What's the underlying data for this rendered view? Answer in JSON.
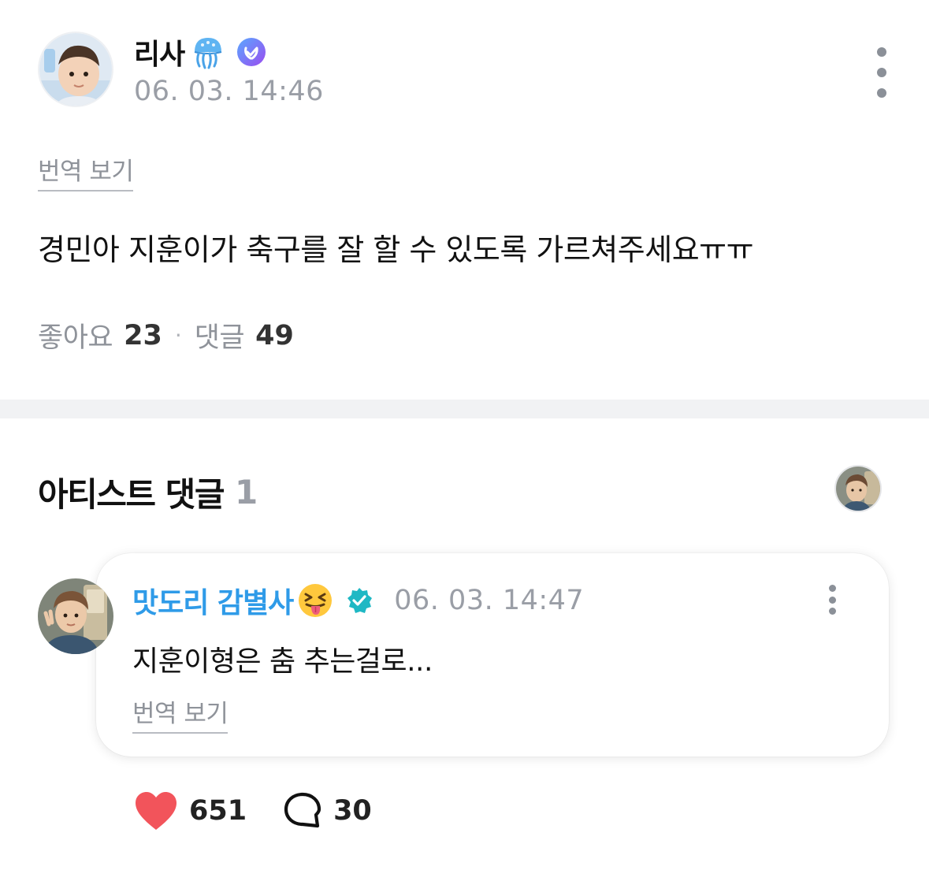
{
  "post": {
    "author_name": "리사",
    "author_emoji": "jellyfish-icon",
    "verified_icon": "verified-badge-purple",
    "timestamp": "06. 03. 14:46",
    "translate_label": "번역 보기",
    "body": "경민아 지훈이가 축구를 잘 할 수 있도록 가르쳐주세요ㅠㅠ",
    "stats": {
      "likes_label": "좋아요",
      "likes_count": "23",
      "separator": "·",
      "comments_label": "댓글",
      "comments_count": "49"
    }
  },
  "artist_comments": {
    "title": "아티스트 댓글",
    "count": "1",
    "comment": {
      "author_name": "맛도리 감별사",
      "author_emoji": "squinting-face-with-tongue-icon",
      "verified_icon": "verified-badge-teal",
      "timestamp": "06. 03. 14:47",
      "text": "지훈이형은 춤 추는걸로...",
      "translate_label": "번역 보기",
      "like_count": "651",
      "reply_count": "30"
    }
  },
  "colors": {
    "accent_blue": "#2f9be8",
    "verified_purple": "#7b5cf5",
    "verified_teal": "#1fb8c4",
    "heart_red": "#f2545b",
    "muted_gray": "#9a9ea6"
  }
}
